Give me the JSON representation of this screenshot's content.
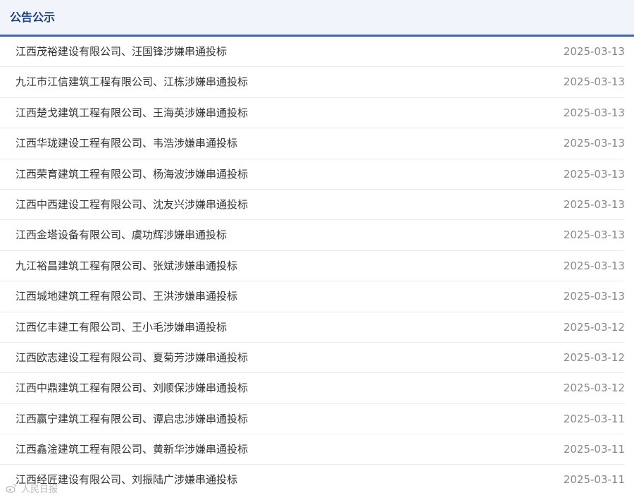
{
  "header": {
    "title": "公告公示"
  },
  "items": [
    {
      "title": "江西茂裕建设有限公司、汪国锋涉嫌串通投标",
      "date": "2025-03-13"
    },
    {
      "title": "九江市江信建筑工程有限公司、江栋涉嫌串通投标",
      "date": "2025-03-13"
    },
    {
      "title": "江西楚戈建筑工程有限公司、王海英涉嫌串通投标",
      "date": "2025-03-13"
    },
    {
      "title": "江西华珑建设工程有限公司、韦浩涉嫌串通投标",
      "date": "2025-03-13"
    },
    {
      "title": "江西荣育建筑工程有限公司、杨海波涉嫌串通投标",
      "date": "2025-03-13"
    },
    {
      "title": "江西中西建设工程有限公司、沈友兴涉嫌串通投标",
      "date": "2025-03-13"
    },
    {
      "title": "江西金塔设备有限公司、虞功辉涉嫌串通投标",
      "date": "2025-03-13"
    },
    {
      "title": "九江裕昌建筑工程有限公司、张斌涉嫌串通投标",
      "date": "2025-03-13"
    },
    {
      "title": "江西城地建筑工程有限公司、王洪涉嫌串通投标",
      "date": "2025-03-13"
    },
    {
      "title": "江西亿丰建工有限公司、王小毛涉嫌串通投标",
      "date": "2025-03-12"
    },
    {
      "title": "江西欧志建设工程有限公司、夏菊芳涉嫌串通投标",
      "date": "2025-03-12"
    },
    {
      "title": "江西中鼎建筑工程有限公司、刘顺保涉嫌串通投标",
      "date": "2025-03-12"
    },
    {
      "title": "江西赢宁建筑工程有限公司、谭启忠涉嫌串通投标",
      "date": "2025-03-11"
    },
    {
      "title": "江西鑫淦建筑工程有限公司、黄新华涉嫌串通投标",
      "date": "2025-03-11"
    },
    {
      "title": "江西经匠建设有限公司、刘振陆广涉嫌串通投标",
      "date": "2025-03-11"
    }
  ],
  "watermark": {
    "text": "人民日报",
    "icon": "weibo-icon"
  }
}
